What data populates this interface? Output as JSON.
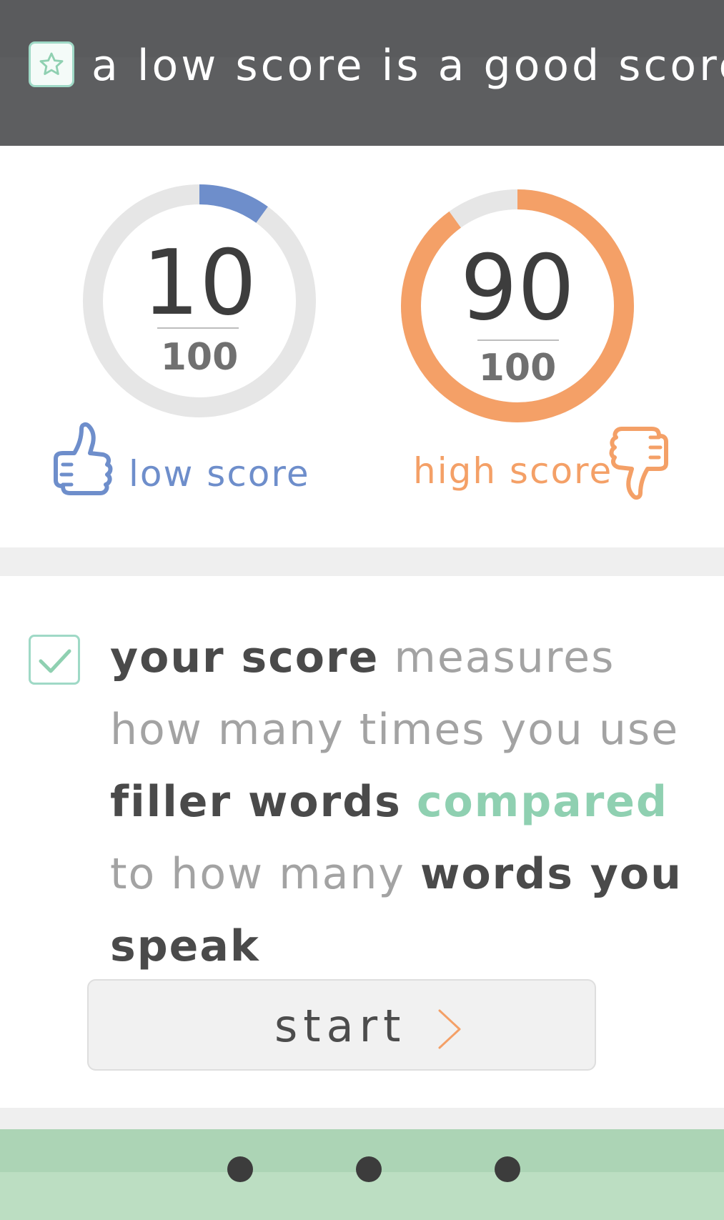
{
  "header": {
    "title": "a low score is a good score",
    "icon": "star-icon"
  },
  "scores": {
    "low": {
      "value": "10",
      "total": "100",
      "label": "low score",
      "fraction": 0.1,
      "color": "#6e8ecb",
      "icon": "thumbs-up-icon"
    },
    "high": {
      "value": "90",
      "total": "100",
      "label": "high score",
      "fraction": 0.9,
      "color": "#f4a067",
      "icon": "thumbs-down-icon"
    }
  },
  "description": {
    "icon": "checkbox-checked-icon",
    "segments": [
      {
        "text": "your score",
        "style": "dark"
      },
      {
        "text": " measures how many times you use ",
        "style": "light"
      },
      {
        "text": "filler words",
        "style": "dark"
      },
      {
        "text": " ",
        "style": "light"
      },
      {
        "text": "compared",
        "style": "accent"
      },
      {
        "text": " to how many ",
        "style": "light"
      },
      {
        "text": "words you speak",
        "style": "dark"
      }
    ]
  },
  "start_button": {
    "label": "start",
    "icon": "chevron-right-icon"
  },
  "pagination": {
    "count": 3
  },
  "colors": {
    "header_bg": "#5d5e60",
    "accent_green": "#8fd0b1",
    "ring_track": "#e6e6e6",
    "pager_bg": "#bcdec2"
  }
}
